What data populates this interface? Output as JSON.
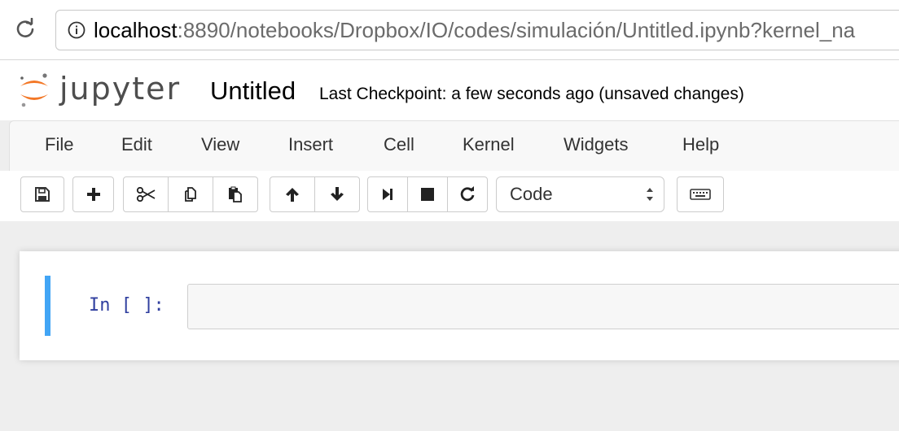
{
  "browser": {
    "url_host": "localhost",
    "url_rest": ":8890/notebooks/Dropbox/IO/codes/simulación/Untitled.ipynb?kernel_na"
  },
  "header": {
    "logo_text": "jupyter",
    "notebook_name": "Untitled",
    "checkpoint_status": "Last Checkpoint: a few seconds ago (unsaved changes)"
  },
  "menu": {
    "items": [
      "File",
      "Edit",
      "View",
      "Insert",
      "Cell",
      "Kernel",
      "Widgets",
      "Help"
    ]
  },
  "toolbar": {
    "cell_type": "Code"
  },
  "cell": {
    "prompt": "In [ ]:",
    "source": ""
  },
  "colors": {
    "accent_blue": "#42a5f5",
    "prompt_blue": "#303f9f",
    "logo_orange": "#f37726"
  }
}
